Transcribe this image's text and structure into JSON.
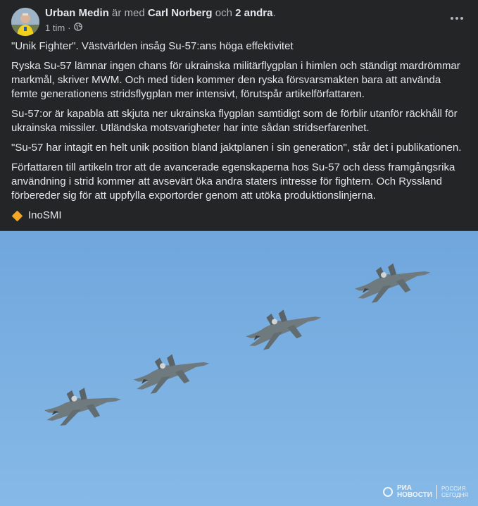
{
  "header": {
    "author": "Urban Medin",
    "with_text": "är med",
    "tagged": "Carl Norberg",
    "and_text": "och",
    "others": "2 andra",
    "period": ".",
    "time": "1 tim",
    "separator": "·",
    "privacy_icon": "globe-icon",
    "more_icon": "more-options-icon"
  },
  "post": {
    "paragraphs": [
      "\"Unik Fighter\". Västvärlden insåg Su-57:ans höga effektivitet",
      "Ryska Su-57 lämnar ingen chans för ukrainska militärflygplan i himlen och ständigt mardrömmar markmål, skriver MWM. Och med tiden kommer den ryska försvarsmakten bara att använda femte generationens stridsflygplan mer intensivt, förutspår artikelförfattaren.",
      "Su-57:or är kapabla att skjuta ner ukrainska flygplan samtidigt som de förblir utanför räckhåll för ukrainska missiler. Utländska motsvarigheter har inte sådan stridserfarenhet.",
      "\"Su-57 har intagit en helt unik position bland jaktplanen i sin generation\", står det i publikationen.",
      "Författaren till artikeln tror att de avancerade egenskaperna hos Su-57 och dess framgångsrika användning i strid kommer att avsevärt öka andra staters intresse för fightern. Och Ryssland förbereder sig för att uppfylla exportorder genom att utöka produktionslinjerna."
    ],
    "source": "InoSMI",
    "source_icon": "orange-diamond-icon"
  },
  "photo": {
    "watermark_left_1": "РИА",
    "watermark_left_2": "НОВОСТИ",
    "watermark_right_1": "РОССИЯ",
    "watermark_right_2": "СЕГОДНЯ",
    "sky_color": "#78aee0"
  }
}
